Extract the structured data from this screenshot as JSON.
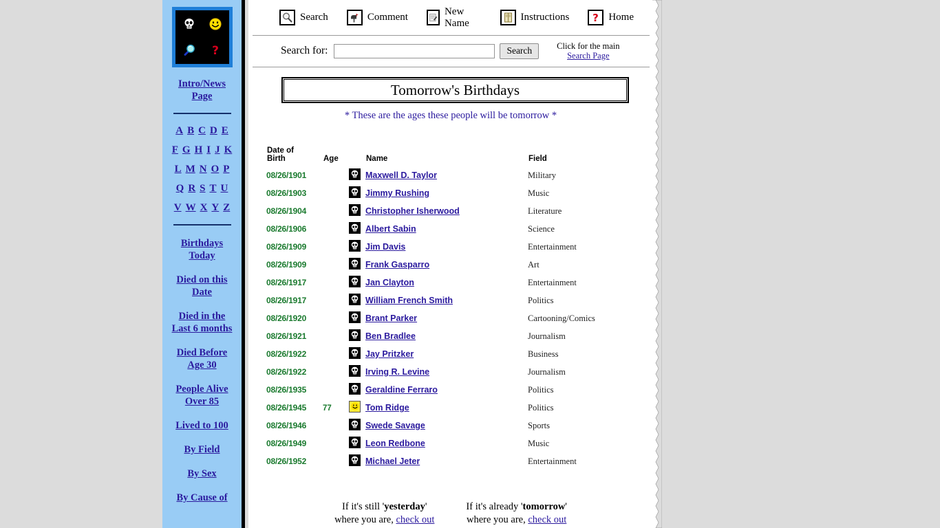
{
  "sidebar": {
    "logo_cells": [
      {
        "name": "skull-icon",
        "glyph": "💀"
      },
      {
        "name": "smiley-icon",
        "glyph": "🙂"
      },
      {
        "name": "magnifier-icon",
        "glyph": "🔍"
      },
      {
        "name": "question-mark-icon",
        "glyph": "?"
      }
    ],
    "intro_line1": "Intro/News",
    "intro_line2": "Page",
    "alphabet_rows": [
      [
        "A",
        "B",
        "C",
        "D",
        "E"
      ],
      [
        "F",
        "G",
        "H",
        "I",
        "J",
        "K"
      ],
      [
        "L",
        "M",
        "N",
        "O",
        "P"
      ],
      [
        "Q",
        "R",
        "S",
        "T",
        "U"
      ],
      [
        "V",
        "W",
        "X",
        "Y",
        "Z"
      ]
    ],
    "links": [
      {
        "l1": "Birthdays",
        "l2": "Today"
      },
      {
        "l1": "Died on this",
        "l2": "Date"
      },
      {
        "l1": "Died in the",
        "l2": "Last 6 months"
      },
      {
        "l1": "Died Before",
        "l2": "Age 30"
      },
      {
        "l1": "People Alive",
        "l2": "Over 85"
      },
      {
        "l1": "Lived to 100",
        "l2": ""
      },
      {
        "l1": "By Field",
        "l2": ""
      },
      {
        "l1": "By Sex",
        "l2": ""
      },
      {
        "l1": "By Cause of",
        "l2": ""
      }
    ]
  },
  "toolbar": {
    "items": [
      {
        "label": "Search",
        "icon": "search-icon",
        "glyph": "🔍"
      },
      {
        "label": "Comment",
        "icon": "mailbox-icon",
        "glyph": "📨"
      },
      {
        "label": "New Name",
        "icon": "notepad-icon",
        "glyph": "📝"
      },
      {
        "label": "Instructions",
        "icon": "book-icon",
        "glyph": "📔"
      },
      {
        "label": "Home",
        "icon": "question-mark-icon",
        "glyph": "?"
      }
    ]
  },
  "search": {
    "label": "Search for:",
    "value": "",
    "placeholder": "",
    "button": "Search",
    "note_line1": "Click for the main",
    "note_link": "Search Page"
  },
  "page": {
    "title": "Tomorrow's Birthdays",
    "subtitle": "* These are the ages these people will be tomorrow *"
  },
  "table": {
    "headers": {
      "dob_l1": "Date of",
      "dob_l2": "Birth",
      "age": "Age",
      "name": "Name",
      "field": "Field"
    },
    "rows": [
      {
        "dob": "08/26/1901",
        "age": "",
        "status": "dead",
        "name": "Maxwell D. Taylor",
        "field": "Military"
      },
      {
        "dob": "08/26/1903",
        "age": "",
        "status": "dead",
        "name": "Jimmy Rushing",
        "field": "Music"
      },
      {
        "dob": "08/26/1904",
        "age": "",
        "status": "dead",
        "name": "Christopher Isherwood",
        "field": "Literature"
      },
      {
        "dob": "08/26/1906",
        "age": "",
        "status": "dead",
        "name": "Albert Sabin",
        "field": "Science"
      },
      {
        "dob": "08/26/1909",
        "age": "",
        "status": "dead",
        "name": "Jim Davis",
        "field": "Entertainment"
      },
      {
        "dob": "08/26/1909",
        "age": "",
        "status": "dead",
        "name": "Frank Gasparro",
        "field": "Art"
      },
      {
        "dob": "08/26/1917",
        "age": "",
        "status": "dead",
        "name": "Jan Clayton",
        "field": "Entertainment"
      },
      {
        "dob": "08/26/1917",
        "age": "",
        "status": "dead",
        "name": "William French Smith",
        "field": "Politics"
      },
      {
        "dob": "08/26/1920",
        "age": "",
        "status": "dead",
        "name": "Brant Parker",
        "field": "Cartooning/Comics"
      },
      {
        "dob": "08/26/1921",
        "age": "",
        "status": "dead",
        "name": "Ben Bradlee",
        "field": "Journalism"
      },
      {
        "dob": "08/26/1922",
        "age": "",
        "status": "dead",
        "name": "Jay Pritzker",
        "field": "Business"
      },
      {
        "dob": "08/26/1922",
        "age": "",
        "status": "dead",
        "name": "Irving R. Levine",
        "field": "Journalism"
      },
      {
        "dob": "08/26/1935",
        "age": "",
        "status": "dead",
        "name": "Geraldine Ferraro",
        "field": "Politics"
      },
      {
        "dob": "08/26/1945",
        "age": "77",
        "status": "alive",
        "name": "Tom Ridge",
        "field": "Politics"
      },
      {
        "dob": "08/26/1946",
        "age": "",
        "status": "dead",
        "name": "Swede Savage",
        "field": "Sports"
      },
      {
        "dob": "08/26/1949",
        "age": "",
        "status": "dead",
        "name": "Leon Redbone",
        "field": "Music"
      },
      {
        "dob": "08/26/1952",
        "age": "",
        "status": "dead",
        "name": "Michael Jeter",
        "field": "Entertainment"
      }
    ]
  },
  "footer": {
    "left_pre": "If it's still '",
    "left_bold": "yesterday",
    "left_post": "'",
    "left_line2_pre": "where you are, ",
    "left_link": "check out",
    "right_pre": "If it's already '",
    "right_bold": "tomorrow",
    "right_post": "'",
    "right_line2_pre": "where you are, ",
    "right_link": "check out"
  },
  "colors": {
    "sidebar_bg": "#99ccf5",
    "link": "#2b1a9e",
    "date_green": "#1a7a2e",
    "page_bg": "#dcdcdc"
  }
}
